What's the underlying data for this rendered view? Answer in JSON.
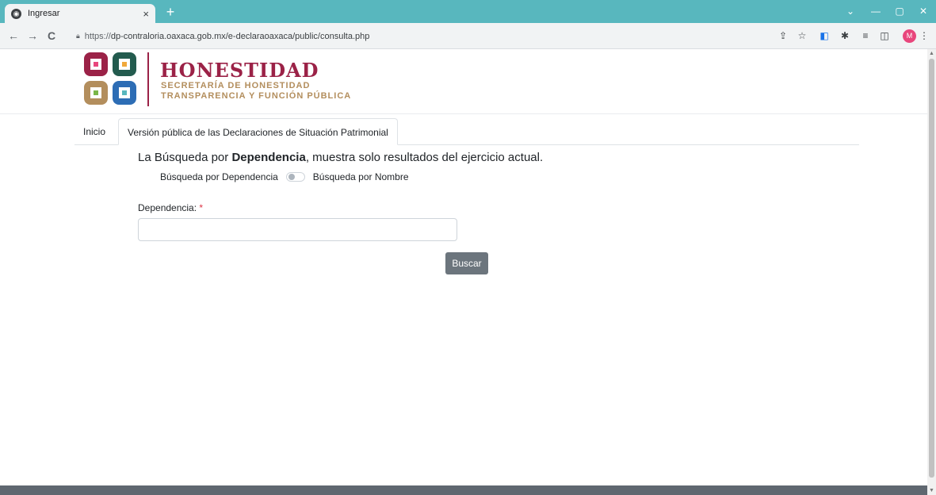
{
  "browser": {
    "tab_title": "Ingresar",
    "tab_close": "×",
    "new_tab": "+",
    "url_scheme": "https://",
    "url_rest": "dp-contraloria.oaxaca.gob.mx/e-declaraoaxaca/public/consulta.php",
    "profile_initial": "M",
    "window_controls": [
      "⌄",
      "—",
      "▢",
      "✕"
    ],
    "nav_back": "←",
    "nav_forward": "→",
    "nav_reload": "C"
  },
  "header": {
    "brand_title": "HONESTIDAD",
    "brand_sub1": "SECRETARÍA DE HONESTIDAD",
    "brand_sub2": "TRANSPARENCIA Y FUNCIÓN PÚBLICA"
  },
  "nav": {
    "items": [
      {
        "label": "Inicio"
      },
      {
        "label": "Versión pública de las Declaraciones de Situación Patrimonial"
      }
    ]
  },
  "main": {
    "headline_prefix": "La Búsqueda por ",
    "headline_bold": "Dependencia",
    "headline_suffix": ", muestra solo resultados del ejercicio actual.",
    "switch_left_label": "Búsqueda por Dependencia",
    "switch_right_label": "Búsqueda por Nombre",
    "field_label": "Dependencia:",
    "required_mark": "*",
    "field_value": "",
    "search_button": "Buscar"
  },
  "colors": {
    "tabbar": "#58b7be",
    "brand": "#9b2247",
    "gold": "#b38e5d",
    "button": "#6c757d"
  }
}
